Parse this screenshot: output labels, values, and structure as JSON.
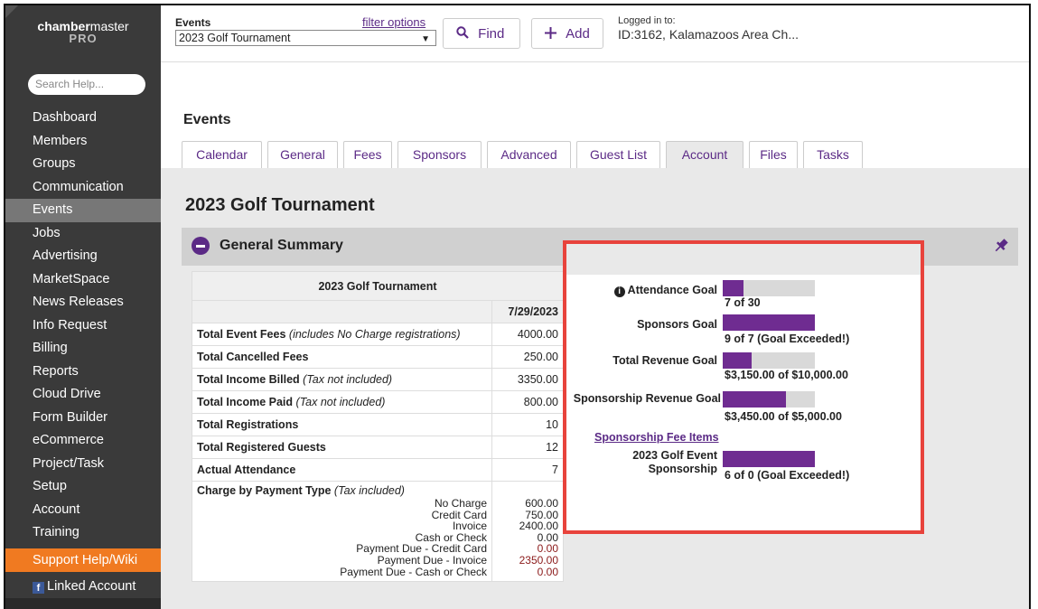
{
  "app": {
    "logo_line1_bold": "chamber",
    "logo_line1_rest": "master",
    "logo_line2": "PRO"
  },
  "sidebar": {
    "search_placeholder": "Search Help...",
    "items": [
      "Dashboard",
      "Members",
      "Groups",
      "Communication",
      "Events",
      "Jobs",
      "Advertising",
      "MarketSpace",
      "News Releases",
      "Info Request",
      "Billing",
      "Reports",
      "Cloud Drive",
      "Form Builder",
      "eCommerce",
      "Project/Task",
      "Setup",
      "Account",
      "Training"
    ],
    "active_item": "Events",
    "support_label": "Support Help/Wiki",
    "linked_account_label": "Linked Account"
  },
  "topbar": {
    "events_label": "Events",
    "filter_options": "filter options",
    "selected_event": "2023 Golf Tournament",
    "find_label": "Find",
    "add_label": "Add",
    "logged_in_label": "Logged in to:",
    "logged_in_value": "ID:3162, Kalamazoos Area Ch..."
  },
  "page": {
    "title": "Events",
    "tabs": [
      "Calendar",
      "General",
      "Fees",
      "Sponsors",
      "Advanced",
      "Guest List",
      "Account",
      "Files",
      "Tasks"
    ],
    "active_tab": "Account",
    "event_name": "2023 Golf Tournament",
    "section_title": "General Summary"
  },
  "summary": {
    "table_title": "2023 Golf Tournament",
    "date_header": "7/29/2023",
    "rows": [
      {
        "label": "Total Event Fees",
        "note": "(includes No Charge registrations)",
        "value": "4000.00"
      },
      {
        "label": "Total Cancelled Fees",
        "note": "",
        "value": "250.00"
      },
      {
        "label": "Total Income Billed",
        "note": "(Tax not included)",
        "value": "3350.00"
      },
      {
        "label": "Total Income Paid",
        "note": "(Tax not included)",
        "value": "800.00"
      },
      {
        "label": "Total Registrations",
        "note": "",
        "value": "10"
      },
      {
        "label": "Total Registered Guests",
        "note": "",
        "value": "12"
      },
      {
        "label": "Actual Attendance",
        "note": "",
        "value": "7"
      }
    ],
    "payment_label": "Charge by Payment Type",
    "payment_note": "(Tax included)",
    "payments": [
      {
        "type": "No Charge",
        "value": "600.00",
        "red": false
      },
      {
        "type": "Credit Card",
        "value": "750.00",
        "red": false
      },
      {
        "type": "Invoice",
        "value": "2400.00",
        "red": false
      },
      {
        "type": "Cash or Check",
        "value": "0.00",
        "red": false
      },
      {
        "type": "Payment Due - Credit Card",
        "value": "0.00",
        "red": true
      },
      {
        "type": "Payment Due - Invoice",
        "value": "2350.00",
        "red": true
      },
      {
        "type": "Payment Due - Cash or Check",
        "value": "0.00",
        "red": true
      }
    ]
  },
  "goals": {
    "attendance": {
      "label": "Attendance Goal",
      "value_text": "7 of 30",
      "fill": 0.23
    },
    "sponsors": {
      "label": "Sponsors Goal",
      "value_text": "9 of 7 (Goal Exceeded!)",
      "fill": 1.0
    },
    "revenue": {
      "label": "Total Revenue Goal",
      "value_text": "$3,150.00 of $10,000.00",
      "fill": 0.315
    },
    "sponsorship_revenue": {
      "label": "Sponsorship Revenue Goal",
      "value_text": "$3,450.00 of $5,000.00",
      "fill": 0.69
    },
    "fee_items_link": "Sponsorship Fee Items",
    "golf_event": {
      "label_line1": "2023 Golf Event",
      "label_line2": "Sponsorship",
      "value_text": "6 of 0 (Goal Exceeded!)",
      "fill": 1.0
    }
  },
  "colors": {
    "brand_purple": "#5b2a86",
    "bar_fill": "#6f2c91",
    "highlight_border": "#e8433c",
    "support_orange": "#f07a21"
  }
}
